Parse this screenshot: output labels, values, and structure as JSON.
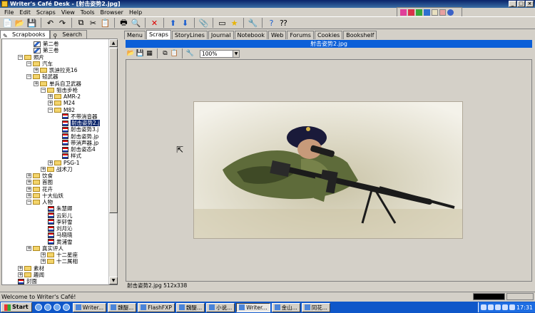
{
  "window": {
    "title": "Writer's Café Desk - [射击姿势2.jpg]",
    "min": "_",
    "max": "□",
    "close": "×"
  },
  "menu": [
    "File",
    "Edit",
    "Scraps",
    "View",
    "Tools",
    "Browser",
    "Help"
  ],
  "left_tabs": [
    {
      "label": "Scrapbooks",
      "icon": "book-icon"
    },
    {
      "label": "Search",
      "icon": "search-icon"
    }
  ],
  "tree": {
    "items": [
      {
        "label": "第二卷",
        "type": "pencil"
      },
      {
        "label": "第三卷",
        "type": "pencil"
      },
      {
        "label": "照片",
        "type": "folder",
        "exp": "−"
      },
      {
        "label": "汽车",
        "type": "folder",
        "exp": "−"
      },
      {
        "label": "凯迪拉克16",
        "type": "folder",
        "exp": "+"
      },
      {
        "label": "轻武器",
        "type": "folder",
        "exp": "−"
      },
      {
        "label": "单兵自卫武器",
        "type": "folder",
        "exp": "+"
      },
      {
        "label": "狙击步枪",
        "type": "folder",
        "exp": "−"
      },
      {
        "label": "AMR-2",
        "type": "folder",
        "exp": "+"
      },
      {
        "label": "M24",
        "type": "folder",
        "exp": "+"
      },
      {
        "label": "M82",
        "type": "folder",
        "exp": "−"
      },
      {
        "label": "不带消音器",
        "type": "doc"
      },
      {
        "label": "射击姿势2.j",
        "type": "doc",
        "selected": true
      },
      {
        "label": "射击姿势3.j",
        "type": "doc"
      },
      {
        "label": "射击姿势.jp",
        "type": "doc"
      },
      {
        "label": "带消声器.jp",
        "type": "doc"
      },
      {
        "label": "射击姿态4",
        "type": "doc"
      },
      {
        "label": "样式",
        "type": "doc"
      },
      {
        "label": "PSG-1",
        "type": "folder",
        "exp": "+"
      },
      {
        "label": "战术刀",
        "type": "folder",
        "exp": "+"
      },
      {
        "label": "饮食",
        "type": "folder",
        "exp": "+"
      },
      {
        "label": "首图",
        "type": "folder",
        "exp": "+"
      },
      {
        "label": "花卉",
        "type": "folder",
        "exp": "+"
      },
      {
        "label": "十大仙妖",
        "type": "folder",
        "exp": "+"
      },
      {
        "label": "人物",
        "type": "folder",
        "exp": "−"
      },
      {
        "label": "朱慧卿",
        "type": "doc"
      },
      {
        "label": "云彩儿",
        "type": "doc"
      },
      {
        "label": "李轩雪",
        "type": "doc"
      },
      {
        "label": "刘月沁",
        "type": "doc"
      },
      {
        "label": "马晓晓",
        "type": "doc"
      },
      {
        "label": "黄浦雪",
        "type": "doc"
      },
      {
        "label": "真实评人",
        "type": "folder",
        "exp": "+"
      },
      {
        "label": "十二星座",
        "type": "folder",
        "exp": "+"
      },
      {
        "label": "十二属相",
        "type": "folder",
        "exp": "+"
      },
      {
        "label": "素材",
        "type": "folder",
        "exp": "+"
      },
      {
        "label": "趣闻",
        "type": "folder",
        "exp": "+"
      },
      {
        "label": "封面",
        "type": "doc"
      }
    ]
  },
  "right_tabs": [
    "Menu",
    "Scraps",
    "StoryLines",
    "Journal",
    "Notebook",
    "Web",
    "Forums",
    "Cookies",
    "Bookshelf"
  ],
  "active_right_tab": "Scraps",
  "image_title": "射击姿势2.jpg",
  "zoom": "100%",
  "image_info": "射击姿势2.jpg 512x338",
  "status": "Welcome to Writer's Café!",
  "taskbar": {
    "start": "Start",
    "tasks": [
      {
        "label": "Writer..."
      },
      {
        "label": "魏醍..."
      },
      {
        "label": "FlashFXP"
      },
      {
        "label": "魏醍..."
      },
      {
        "label": "小说..."
      },
      {
        "label": "Writer...",
        "active": true
      },
      {
        "label": "金山..."
      },
      {
        "label": "同花..."
      }
    ],
    "clock": "17:31"
  }
}
